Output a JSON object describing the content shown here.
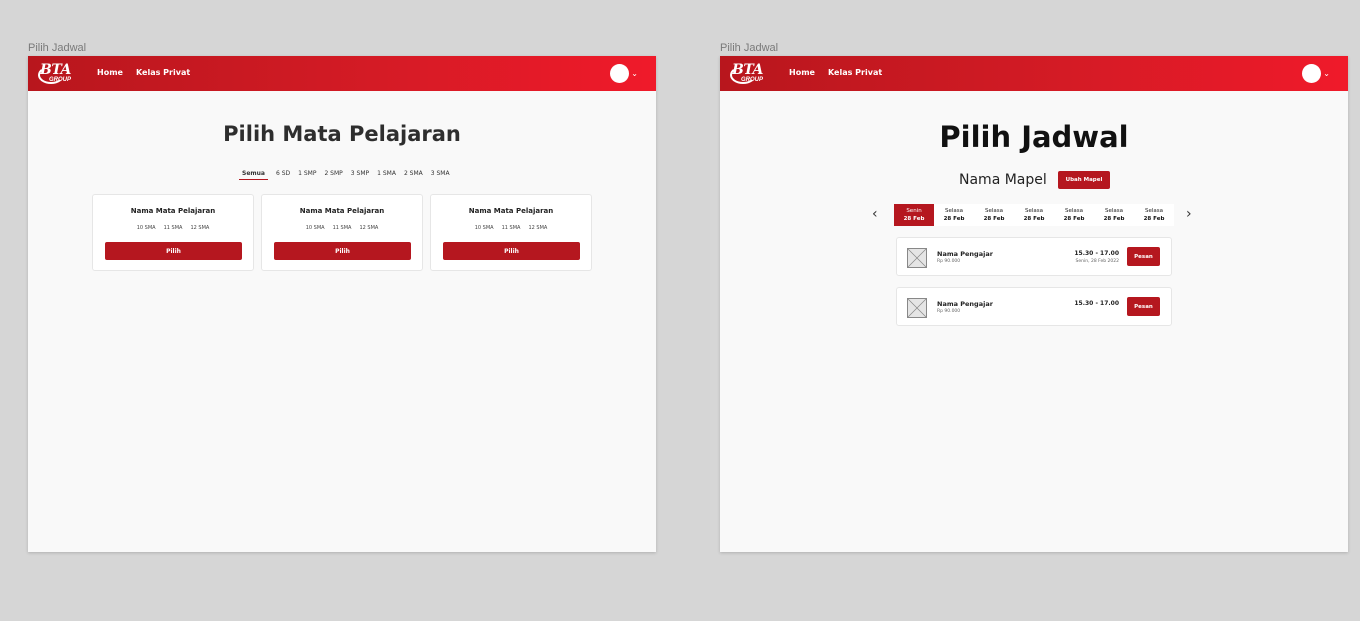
{
  "frames": {
    "left_label": "Pilih Jadwal",
    "right_label": "Pilih Jadwal"
  },
  "navbar": {
    "logo_text": "BTA",
    "logo_sub": "GROUP",
    "home": "Home",
    "kelas_privat": "Kelas Privat",
    "avatar_chevron": "⌄"
  },
  "mapel_page": {
    "title": "Pilih Mata Pelajaran",
    "tabs": [
      "Semua",
      "6 SD",
      "1 SMP",
      "2 SMP",
      "3 SMP",
      "1 SMA",
      "2 SMA",
      "3 SMA"
    ],
    "active_tab": "Semua",
    "cards": [
      {
        "name": "Nama Mata Pelajaran",
        "grades": [
          "10 SMA",
          "11 SMA",
          "12 SMA"
        ],
        "button": "Pilih"
      },
      {
        "name": "Nama Mata Pelajaran",
        "grades": [
          "10 SMA",
          "11 SMA",
          "12 SMA"
        ],
        "button": "Pilih"
      },
      {
        "name": "Nama Mata Pelajaran",
        "grades": [
          "10 SMA",
          "11 SMA",
          "12 SMA"
        ],
        "button": "Pilih"
      }
    ]
  },
  "jadwal_page": {
    "title": "Pilih Jadwal",
    "mapel_name": "Nama Mapel",
    "ubah_button": "Ubah Mapel",
    "prev_arrow": "‹",
    "next_arrow": "›",
    "days": [
      {
        "name": "Senin",
        "date": "28 Feb",
        "active": true
      },
      {
        "name": "Selasa",
        "date": "28 Feb",
        "active": false
      },
      {
        "name": "Selasa",
        "date": "28 Feb",
        "active": false
      },
      {
        "name": "Selasa",
        "date": "28 Feb",
        "active": false
      },
      {
        "name": "Selasa",
        "date": "28 Feb",
        "active": false
      },
      {
        "name": "Selasa",
        "date": "28 Feb",
        "active": false
      },
      {
        "name": "Selasa",
        "date": "28 Feb",
        "active": false
      }
    ],
    "schedules": [
      {
        "teacher": "Nama Pengajar",
        "price": "Rp 90.000",
        "time": "15.30 - 17.00",
        "date": "Senin, 28 Feb 2022",
        "button": "Pesan"
      },
      {
        "teacher": "Nama Pengajar",
        "price": "Rp 90.000",
        "time": "15.30 - 17.00",
        "date": "",
        "button": "Pesan"
      }
    ]
  },
  "colors": {
    "primary": "#b5171f",
    "navbar_start": "#b8161d",
    "navbar_end": "#f01a2a",
    "page_bg": "#f9f9f9",
    "canvas_bg": "#d6d6d6"
  }
}
